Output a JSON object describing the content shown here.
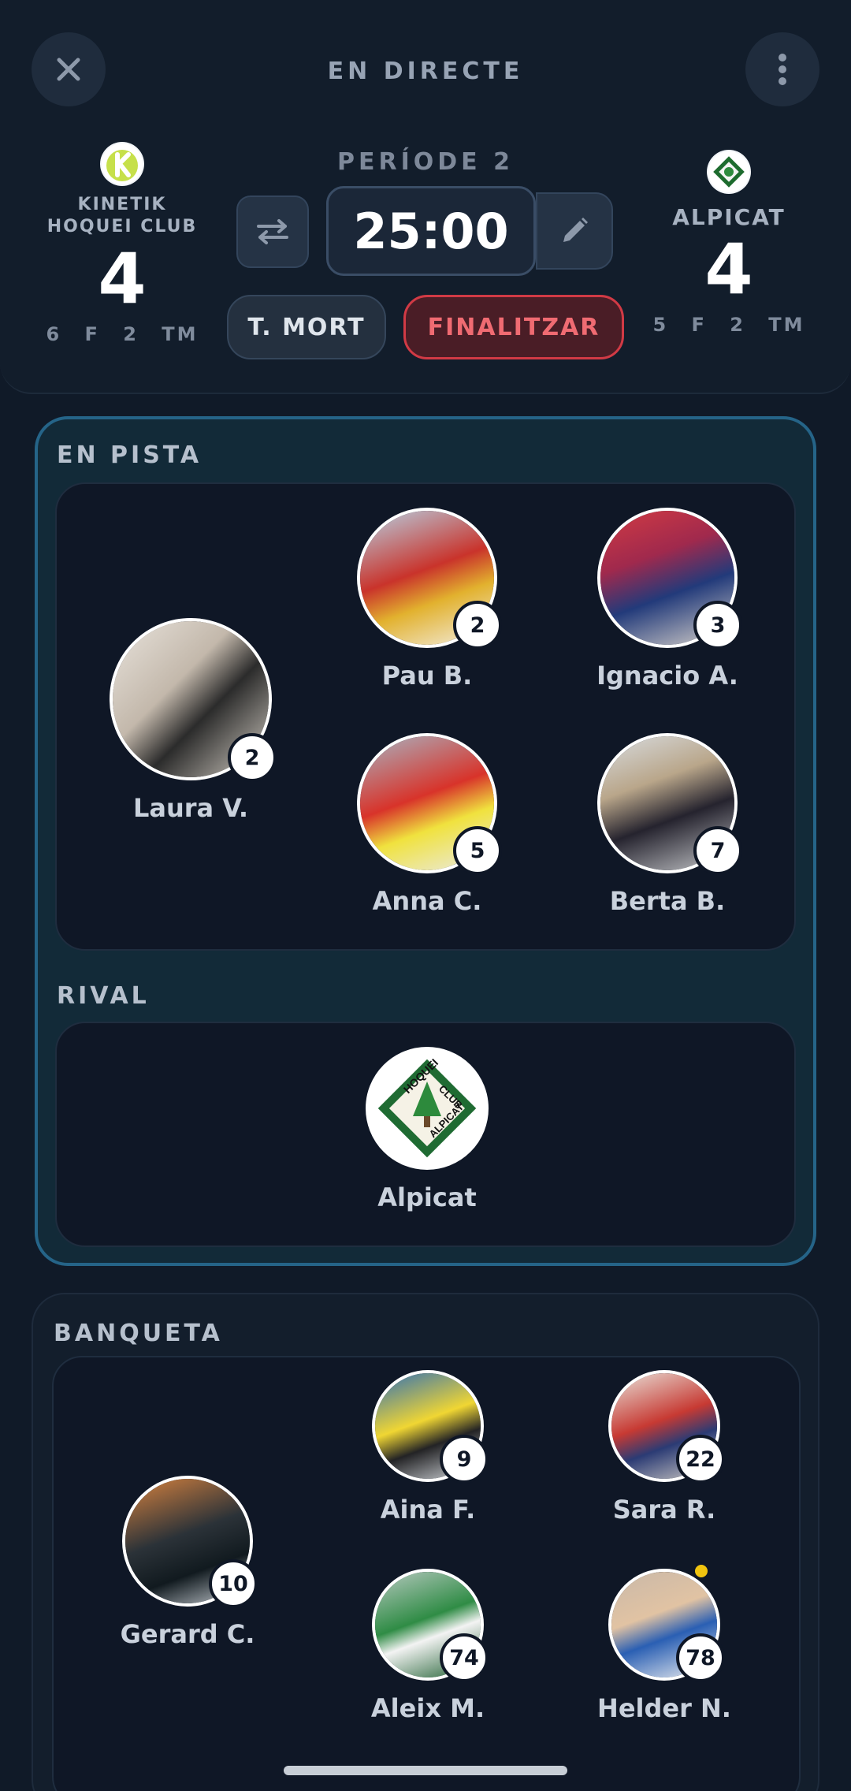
{
  "header": {
    "title": "EN DIRECTE",
    "period": "PERÍODE 2",
    "clock": "25:00",
    "timeout_label": "T. MORT",
    "finish_label": "FINALITZAR"
  },
  "home_team": {
    "name": "KINETIK HOQUEI CLUB",
    "score": "4",
    "stats": "6 F  2 TM"
  },
  "away_team": {
    "name": "ALPICAT",
    "score": "4",
    "stats": "5 F  2 TM"
  },
  "court": {
    "title": "EN PISTA",
    "goalkeeper": {
      "name": "Laura V.",
      "number": "2"
    },
    "players": [
      {
        "name": "Pau B.",
        "number": "2"
      },
      {
        "name": "Ignacio A.",
        "number": "3"
      },
      {
        "name": "Anna C.",
        "number": "5"
      },
      {
        "name": "Berta B.",
        "number": "7"
      }
    ]
  },
  "rival": {
    "title": "RIVAL",
    "name": "Alpicat",
    "logo_text": [
      "HOQUEI",
      "CLUB",
      "ALPICAT"
    ]
  },
  "bench": {
    "title": "BANQUETA",
    "goalkeeper": {
      "name": "Gerard C.",
      "number": "10"
    },
    "players": [
      {
        "name": "Aina F.",
        "number": "9"
      },
      {
        "name": "Sara R.",
        "number": "22"
      },
      {
        "name": "Aleix M.",
        "number": "74"
      },
      {
        "name": "Helder N.",
        "number": "78"
      }
    ]
  },
  "colors": {
    "accent": "#256488",
    "danger": "#d13a45",
    "warning_dot": "#f1c40f"
  }
}
